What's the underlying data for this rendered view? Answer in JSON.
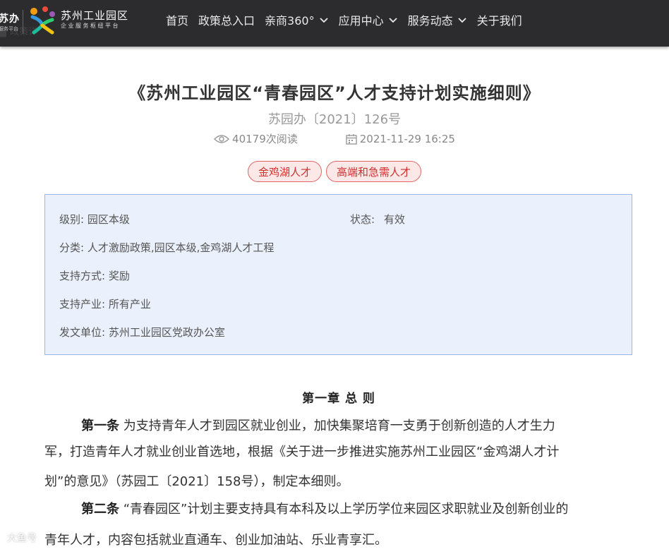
{
  "header": {
    "brand_left": "苏办",
    "brand_left_sub": "服务平台",
    "brand_name": "苏州工业园区",
    "brand_sub": "企业服务枢纽平台",
    "ghost_crumb": "▉ 政策详",
    "nav": [
      {
        "label": "首页",
        "dropdown": false
      },
      {
        "label": "政策总入口",
        "dropdown": false
      },
      {
        "label": "亲商360°",
        "dropdown": true
      },
      {
        "label": "应用中心",
        "dropdown": true
      },
      {
        "label": "服务动态",
        "dropdown": true
      },
      {
        "label": "关于我们",
        "dropdown": false
      }
    ]
  },
  "article": {
    "title": "《苏州工业园区“青春园区”人才支持计划实施细则》",
    "doc_number": "苏园办〔2021〕126号",
    "reads": "40179次阅读",
    "date": "2021-11-29 16:25",
    "tags": [
      "金鸡湖人才",
      "高端和急需人才"
    ]
  },
  "info": {
    "level_label": "级别:",
    "level_value": "园区本级",
    "status_label": "状态:",
    "status_value": "有效",
    "category_label": "分类:",
    "category_value": "人才激励政策,园区本级,金鸡湖人才工程",
    "support_label": "支持方式:",
    "support_value": "奖励",
    "industry_label": "支持产业:",
    "industry_value": "所有产业",
    "issuer_label": "发文单位:",
    "issuer_value": "苏州工业园区党政办公室"
  },
  "body": {
    "chapter": "第一章  总 则",
    "art1_head": "第一条",
    "art1_l1": "  为支持青年人才到园区就业创业，加快集聚培育一支勇于创新创造的人才生力",
    "art1_l2": "军，打造青年人才就业创业首选地，根据《关于进一步推进实施苏州工业园区“金鸡湖人才计",
    "art1_l3": "划”的意见》（苏园工〔2021〕158号），制定本细则。",
    "art2_head": "第二条",
    "art2_l1": "  “青春园区”计划主要支持具有本科及以上学历学位来园区求职就业及创新创业的",
    "art2_l2": "青年人才，内容包括就业直通车、创业加油站、乐业青享汇。"
  },
  "watermark": "大鱼号"
}
